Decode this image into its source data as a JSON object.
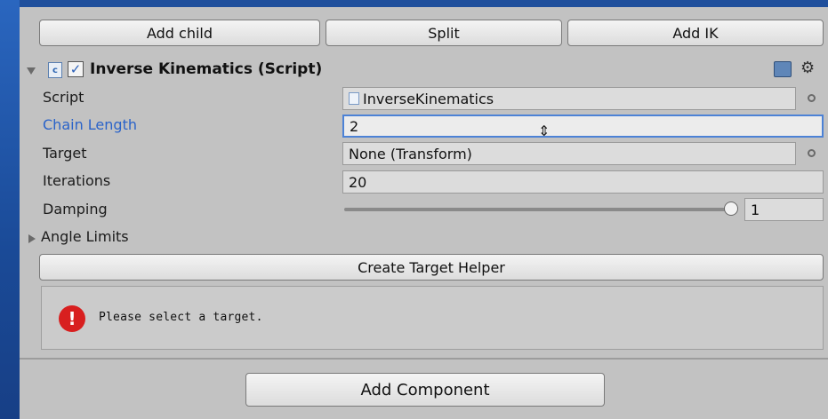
{
  "toolbar": {
    "add_child": "Add child",
    "split": "Split",
    "add_ik": "Add IK"
  },
  "component": {
    "title": "Inverse Kinematics (Script)",
    "enabled": true,
    "icons": {
      "expand": "triangle-down-icon",
      "script": "cs-script-icon",
      "help": "book-icon",
      "settings": "gear-icon"
    }
  },
  "fields": {
    "script": {
      "label": "Script",
      "value": "InverseKinematics"
    },
    "chain_length": {
      "label": "Chain Length",
      "value": "2"
    },
    "target": {
      "label": "Target",
      "value": "None (Transform)"
    },
    "iterations": {
      "label": "Iterations",
      "value": "20"
    },
    "damping": {
      "label": "Damping",
      "value": "1",
      "level": 1.0
    },
    "angle_limits": {
      "label": "Angle Limits"
    }
  },
  "create_target_helper": "Create Target Helper",
  "help": {
    "message": "Please select a target.",
    "icon": "error-icon"
  },
  "add_component": "Add Component",
  "colors": {
    "background": "#1f4f9c",
    "panel": "#c2c2c2",
    "label_focus": "#2a63c9",
    "field_focus_border": "#4c82d6",
    "error": "#d81f1f"
  }
}
